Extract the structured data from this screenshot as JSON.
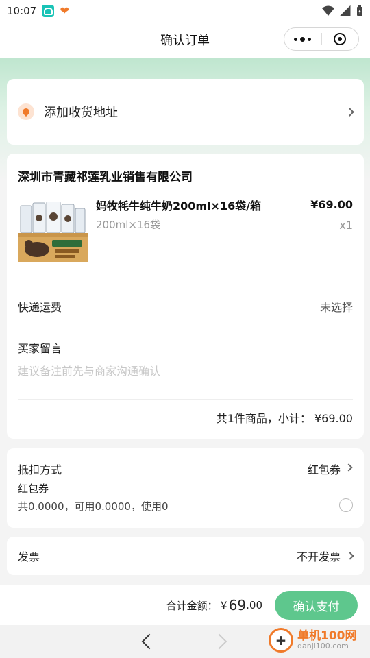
{
  "status_bar": {
    "time": "10:07"
  },
  "navbar": {
    "title": "确认订单"
  },
  "address": {
    "label": "添加收货地址"
  },
  "order": {
    "shop_name": "深圳市青藏祁莲乳业销售有限公司",
    "product": {
      "title": "妈牧牦牛纯牛奶200ml×16袋/箱",
      "spec": "200ml×16袋",
      "price": "¥69.00",
      "quantity": "x1"
    },
    "shipping_label": "快递运费",
    "shipping_value": "未选择",
    "message_label": "买家留言",
    "message_placeholder": "建议备注前先与商家沟通确认",
    "subtotal": "共1件商品，小计： ¥69.00"
  },
  "discount": {
    "title": "抵扣方式",
    "method": "红包券",
    "coupon_label": "红包券",
    "coupon_info": "共0.0000，可用0.0000，使用0",
    "selected": false
  },
  "invoice": {
    "label": "发票",
    "value": "不开发票"
  },
  "footer": {
    "total_label": "合计金额：",
    "currency": "¥",
    "total_int": "69",
    "total_dec": ".00",
    "pay_button": "确认支付"
  },
  "watermark": {
    "name": "单机100网",
    "domain": "danji100.com"
  },
  "colors": {
    "accent_green": "#5ec78d",
    "accent_orange": "#f07a2a"
  }
}
